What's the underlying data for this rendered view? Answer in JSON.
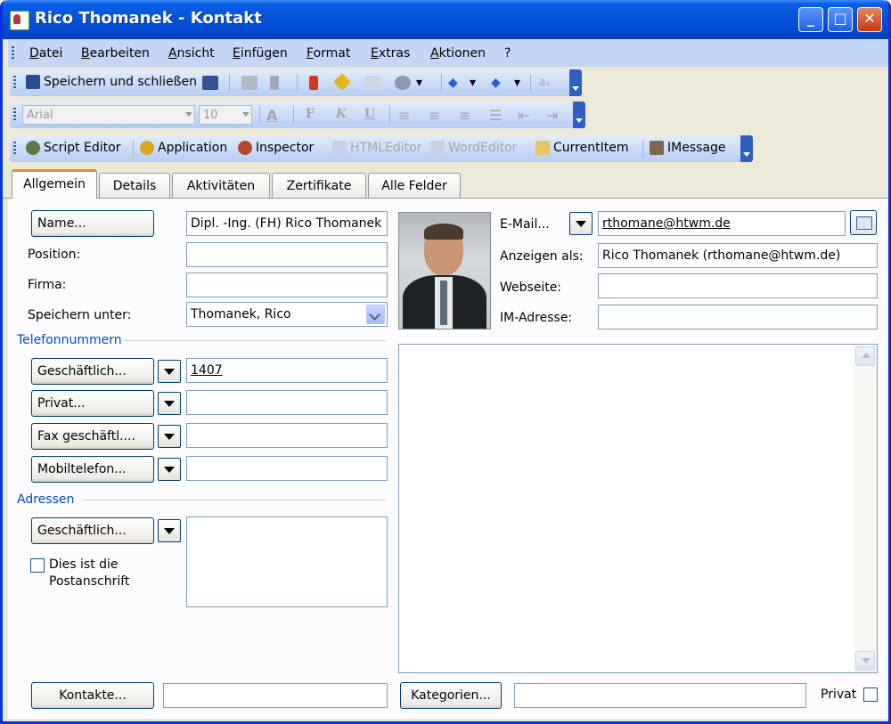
{
  "window": {
    "title": "Rico Thomanek - Kontakt"
  },
  "menu": [
    "Datei",
    "Bearbeiten",
    "Ansicht",
    "Einfügen",
    "Format",
    "Extras",
    "Aktionen",
    "?"
  ],
  "toolbar1": {
    "save_close_label": "Speichern und schließen"
  },
  "toolbar2": {
    "font_name": "Arial",
    "font_size": "10",
    "bold": "F",
    "italic": "K",
    "underline": "U"
  },
  "toolbar3": {
    "items": [
      "Script Editor",
      "Application",
      "Inspector",
      "HTMLEditor",
      "WordEditor",
      "CurrentItem",
      "IMessage"
    ]
  },
  "tabs": [
    "Allgemein",
    "Details",
    "Aktivitäten",
    "Zertifikate",
    "Alle Felder"
  ],
  "general": {
    "name_button": "Name...",
    "name_value": "Dipl. -Ing. (FH) Rico Thomanek",
    "position_label": "Position:",
    "position_value": "",
    "company_label": "Firma:",
    "company_value": "",
    "save_as_label": "Speichern unter:",
    "save_as_value": "Thomanek, Rico"
  },
  "phone": {
    "section_title": "Telefonnummern",
    "items": [
      {
        "label": "Geschäftlich...",
        "value": "1407"
      },
      {
        "label": "Privat...",
        "value": ""
      },
      {
        "label": "Fax geschäftl....",
        "value": ""
      },
      {
        "label": "Mobiltelefon...",
        "value": ""
      }
    ]
  },
  "address": {
    "section_title": "Adressen",
    "button": "Geschäftlich...",
    "value": "",
    "mailing_checkbox_label_line1": "Dies ist die",
    "mailing_checkbox_label_line2": "Postanschrift"
  },
  "internet": {
    "email_button": "E-Mail...",
    "email_value": "rthomane@htwm.de",
    "display_as_label": "Anzeigen als:",
    "display_as_value": "Rico Thomanek (rthomane@htwm.de)",
    "website_label": "Webseite:",
    "website_value": "",
    "im_label": "IM-Adresse:",
    "im_value": ""
  },
  "footer": {
    "contacts_button": "Kontakte...",
    "contacts_value": "",
    "categories_button": "Kategorien...",
    "categories_value": "",
    "private_label": "Privat"
  }
}
